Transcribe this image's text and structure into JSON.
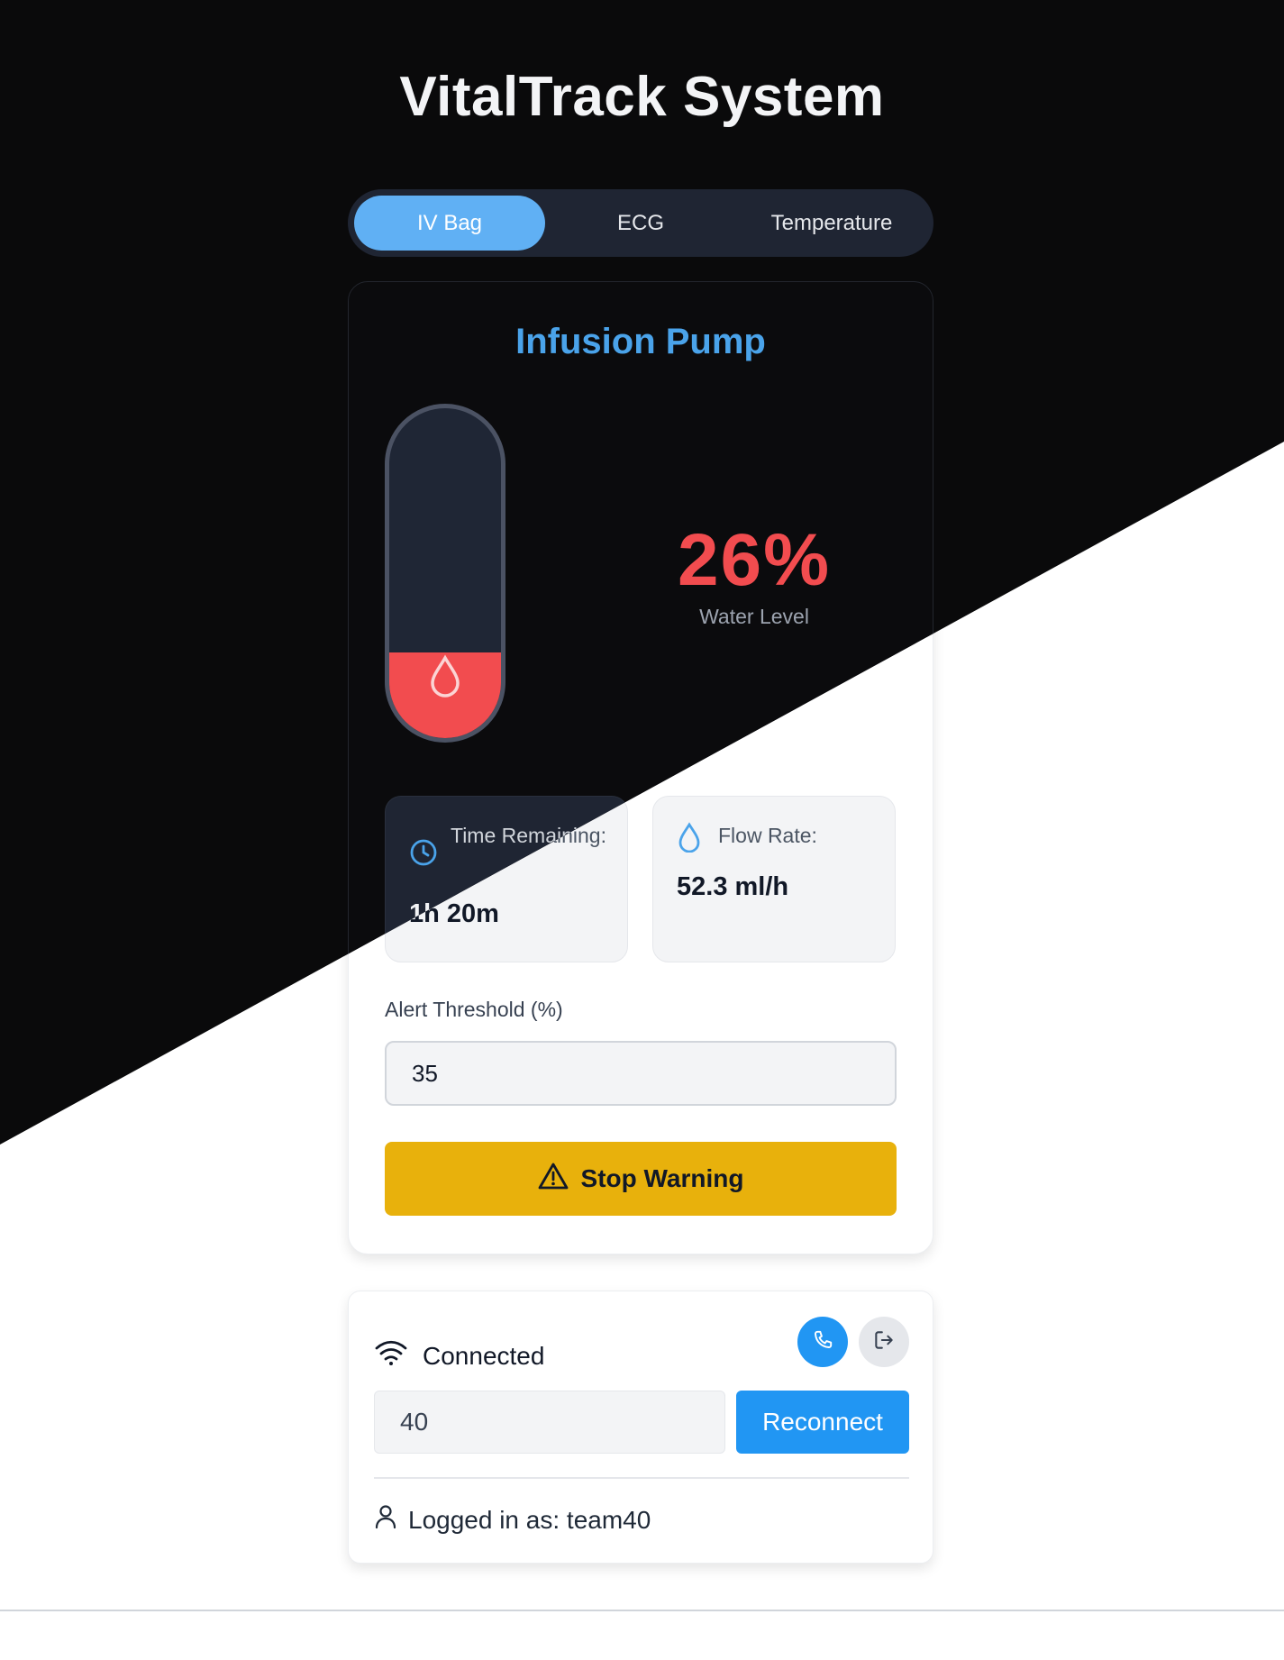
{
  "app": {
    "title": "VitalTrack System"
  },
  "tabs": [
    {
      "label": "IV Bag",
      "active": true
    },
    {
      "label": "ECG",
      "active": false
    },
    {
      "label": "Temperature",
      "active": false
    }
  ],
  "pump": {
    "title": "Infusion Pump",
    "level_percent": 26,
    "level_text": "26%",
    "level_label": "Water Level",
    "level_color": "#f24c4f",
    "time_remaining_label": "Time Remaining:",
    "time_remaining_value": "1h 20m",
    "flow_rate_label": "Flow Rate:",
    "flow_rate_value": "52.3 ml/h",
    "alert_threshold_label": "Alert Threshold (%)",
    "alert_threshold_value": "35",
    "stop_warning_label": "Stop Warning",
    "accent_color": "#4aa3ea",
    "warning_color": "#e8b10c"
  },
  "connection": {
    "status": "Connected",
    "team_value": "40",
    "reconnect_label": "Reconnect",
    "logged_in_text": "Logged in as: team40",
    "button_color": "#2196f3"
  },
  "icons": {
    "drop": "drop-icon",
    "clock": "clock-icon",
    "warning": "warning-triangle-icon",
    "wifi": "wifi-icon",
    "phone": "phone-icon",
    "logout": "logout-icon",
    "user": "user-icon"
  }
}
